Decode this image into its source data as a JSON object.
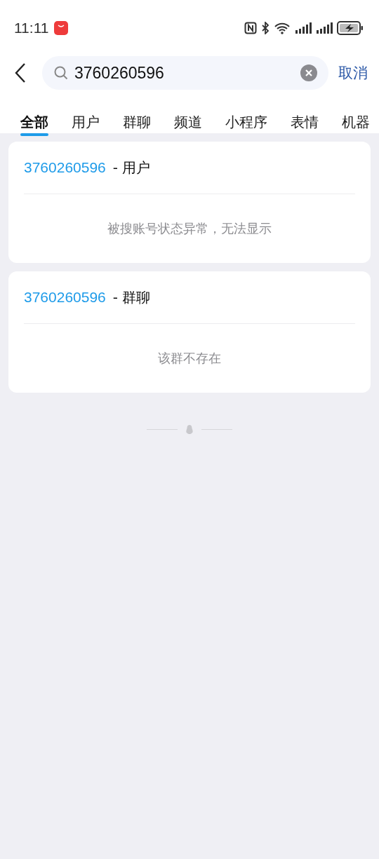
{
  "status_bar": {
    "time": "11:11"
  },
  "search": {
    "value": "3760260596",
    "cancel": "取消"
  },
  "tabs": [
    {
      "label": "全部",
      "selected": true
    },
    {
      "label": "用户",
      "selected": false
    },
    {
      "label": "群聊",
      "selected": false
    },
    {
      "label": "频道",
      "selected": false
    },
    {
      "label": "小程序",
      "selected": false
    },
    {
      "label": "表情",
      "selected": false
    },
    {
      "label": "机器",
      "selected": false
    }
  ],
  "results": [
    {
      "number": "3760260596",
      "type": "- 用户",
      "message": "被搜账号状态异常，无法显示"
    },
    {
      "number": "3760260596",
      "type": "- 群聊",
      "message": "该群不存在"
    }
  ]
}
